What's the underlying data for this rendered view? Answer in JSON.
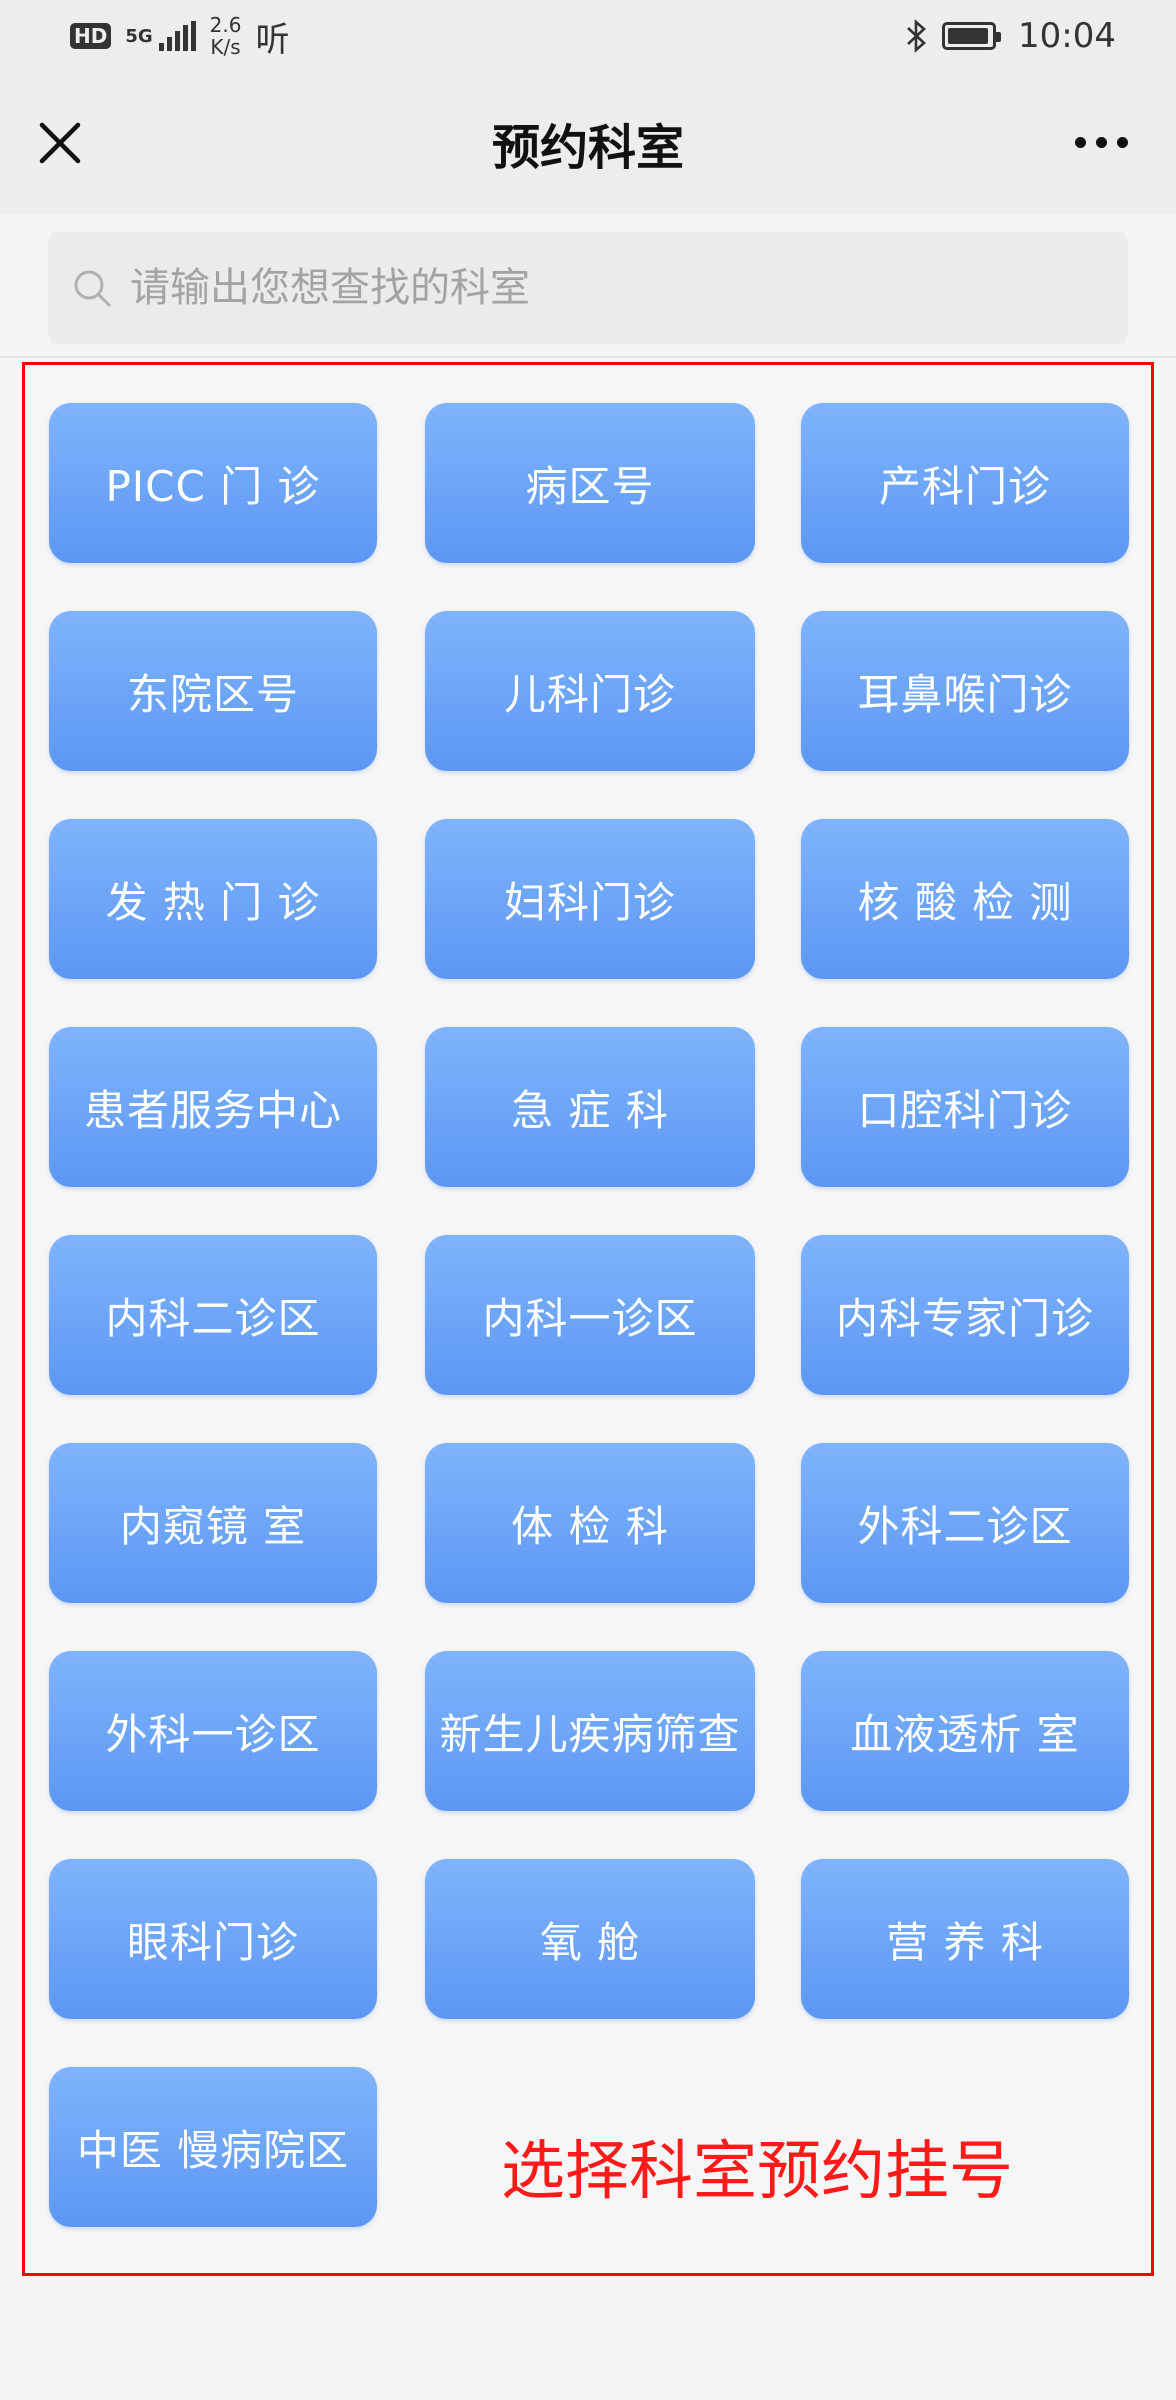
{
  "status_bar": {
    "hd": "HD",
    "network": "5G",
    "speed_value": "2.6",
    "speed_unit": "K/s",
    "listen": "听",
    "time": "10:04",
    "battery_level": 0.95
  },
  "nav": {
    "title": "预约科室"
  },
  "search": {
    "placeholder": "请输出您想查找的科室",
    "value": ""
  },
  "departments": [
    "PICC 门 诊",
    "病区号",
    "产科门诊",
    "东院区号",
    "儿科门诊",
    "耳鼻喉门诊",
    "发 热 门 诊",
    "妇科门诊",
    "核 酸 检 测",
    "患者服务中心",
    "急 症 科",
    "口腔科门诊",
    "内科二诊区",
    "内科一诊区",
    "内科专家门诊",
    "内窥镜 室",
    "体 检 科",
    "外科二诊区",
    "外科一诊区",
    "新生儿疾病筛查",
    "血液透析 室",
    "眼科门诊",
    "氧 舱",
    "营 养 科",
    "中医 慢病院区"
  ],
  "annotation": "选择科室预约挂号",
  "colors": {
    "button_top": "#7fb4fb",
    "button_bottom": "#5c97f4",
    "annotation": "#ff1a1a",
    "panel_border": "#ff0000"
  }
}
